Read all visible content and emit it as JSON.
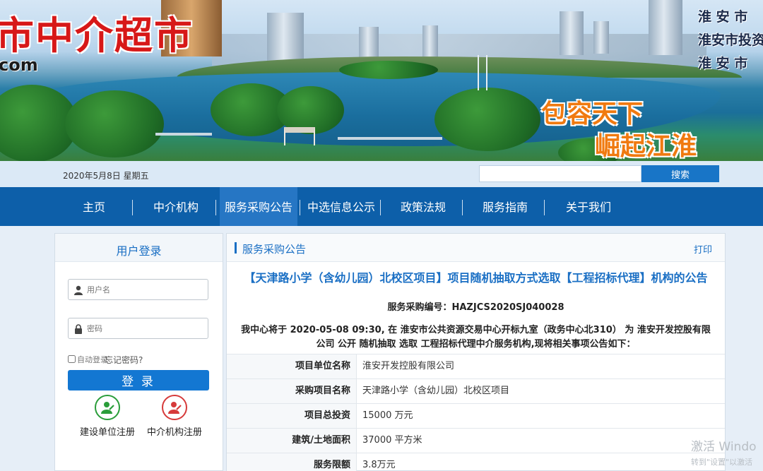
{
  "banner": {
    "site_title": "市中介超市",
    "site_domain": "com",
    "slogan_line1": "包容天下",
    "slogan_line2": "崛起江淮",
    "side_links": [
      "淮 安 市",
      "淮安市投资",
      "淮 安 市"
    ]
  },
  "header": {
    "date": "2020年5月8日 星期五",
    "search": {
      "placeholder": "",
      "button": "搜索"
    }
  },
  "nav": {
    "items": [
      "主页",
      "中介机构",
      "服务采购公告",
      "中选信息公示",
      "政策法规",
      "服务指南",
      "关于我们"
    ],
    "active": "服务采购公告"
  },
  "login": {
    "title": "用户登录",
    "username_placeholder": "用户名",
    "password_placeholder": "密码",
    "remember_label": "自动登录",
    "forgot_label": "忘记密码?",
    "login_button": "登 录",
    "register_buttons": [
      "建设单位注册",
      "中介机构注册"
    ]
  },
  "main": {
    "section_title": "服务采购公告",
    "print_label": "打印",
    "article_title": "【天津路小学（含幼儿园）北校区项目】项目随机抽取方式选取【工程招标代理】机构的公告",
    "code_line": "服务采购编号：HAZJCS2020SJ040028",
    "intro_line1": "我中心将于 2020-05-08 09:30, 在 淮安市公共资源交易中心开标九室（政务中心北310） 为 淮安开发控股有限",
    "intro_line2": "公司 公开 随机抽取 选取 工程招标代理中介服务机构,现将相关事项公告如下：",
    "rows": [
      {
        "label": "项目单位名称",
        "value": "淮安开发控股有限公司"
      },
      {
        "label": "采购项目名称",
        "value": "天津路小学（含幼儿园）北校区项目"
      },
      {
        "label": "项目总投资",
        "value": "15000 万元"
      },
      {
        "label": "建筑/土地面积",
        "value": "37000 平方米"
      },
      {
        "label": "服务限额",
        "value": "3.8万元"
      }
    ]
  },
  "watermark": {
    "line1": "激活 Windo",
    "line2": "转到\"设置\"以激活"
  },
  "colors": {
    "nav_bg": "#0d5fa9",
    "nav_active": "#2676c4",
    "accent": "#1a6fc4",
    "title_red": "#d71818",
    "slogan_orange": "#f07a10",
    "login_button": "#1377d2",
    "register_green": "#2a9d3a",
    "register_red": "#d63a3a"
  }
}
